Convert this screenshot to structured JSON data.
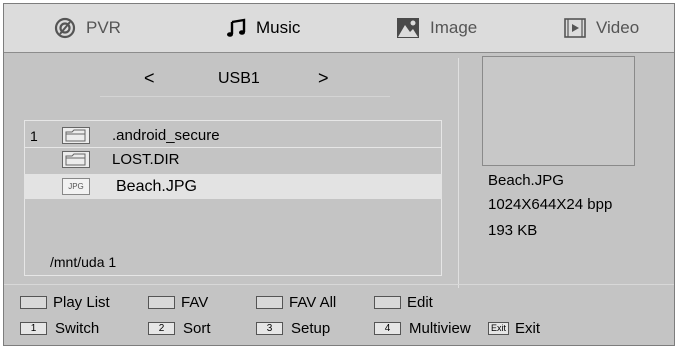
{
  "tabs": [
    {
      "label": "PVR",
      "icon": "pvr-icon",
      "active": false
    },
    {
      "label": "Music",
      "icon": "music-note-icon",
      "active": true
    },
    {
      "label": "Image",
      "icon": "image-icon",
      "active": false
    },
    {
      "label": "Video",
      "icon": "video-icon",
      "active": false
    }
  ],
  "nav": {
    "prev": "<",
    "next": ">",
    "device": "USB1"
  },
  "files": [
    {
      "num": "1",
      "name": ".android_secure",
      "type": "folder",
      "selected": false
    },
    {
      "num": "",
      "name": "LOST.DIR",
      "type": "folder",
      "selected": false
    },
    {
      "num": "",
      "name": "Beach.JPG",
      "type": "jpg",
      "badge": "JPG",
      "selected": true
    }
  ],
  "path": "/mnt/uda 1",
  "info": {
    "filename": "Beach.JPG",
    "resolution": "1024X644X24 bpp",
    "size": "193 KB"
  },
  "color_keys": [
    {
      "label": "Play List"
    },
    {
      "label": "FAV"
    },
    {
      "label": "FAV All"
    },
    {
      "label": "Edit"
    }
  ],
  "num_keys": [
    {
      "key": "1",
      "label": "Switch"
    },
    {
      "key": "2",
      "label": "Sort"
    },
    {
      "key": "3",
      "label": "Setup"
    },
    {
      "key": "4",
      "label": "Multiview"
    }
  ],
  "exit_key": {
    "key": "Exit",
    "label": "Exit"
  },
  "colors": {
    "background": "#c4c4c4",
    "tabbar": "#dcdcdc",
    "selected_row": "#e3e3e3"
  }
}
